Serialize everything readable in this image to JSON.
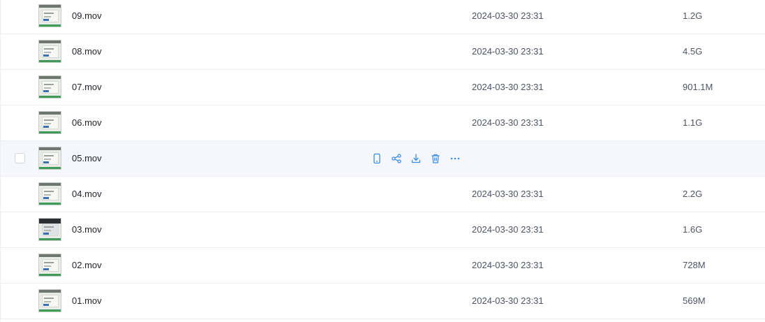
{
  "files": [
    {
      "name": "09.mov",
      "modified": "2024-03-30 23:31",
      "size": "1.2G"
    },
    {
      "name": "08.mov",
      "modified": "2024-03-30 23:31",
      "size": "4.5G"
    },
    {
      "name": "07.mov",
      "modified": "2024-03-30 23:31",
      "size": "901.1M"
    },
    {
      "name": "06.mov",
      "modified": "2024-03-30 23:31",
      "size": "1.1G"
    },
    {
      "name": "05.mov",
      "modified": "",
      "size": ""
    },
    {
      "name": "04.mov",
      "modified": "2024-03-30 23:31",
      "size": "2.2G"
    },
    {
      "name": "03.mov",
      "modified": "2024-03-30 23:31",
      "size": "1.6G"
    },
    {
      "name": "02.mov",
      "modified": "2024-03-30 23:31",
      "size": "728M"
    },
    {
      "name": "01.mov",
      "modified": "2024-03-30 23:31",
      "size": "569M"
    }
  ],
  "hovered_row_actions": [
    "phone-icon",
    "share-icon",
    "download-icon",
    "delete-icon",
    "more-icon"
  ],
  "colors": {
    "accent": "#3a8ee6",
    "hover_bg": "#f5f7fc",
    "divider": "#eceef2",
    "text_primary": "#1f2329",
    "text_secondary": "#4e5461"
  }
}
